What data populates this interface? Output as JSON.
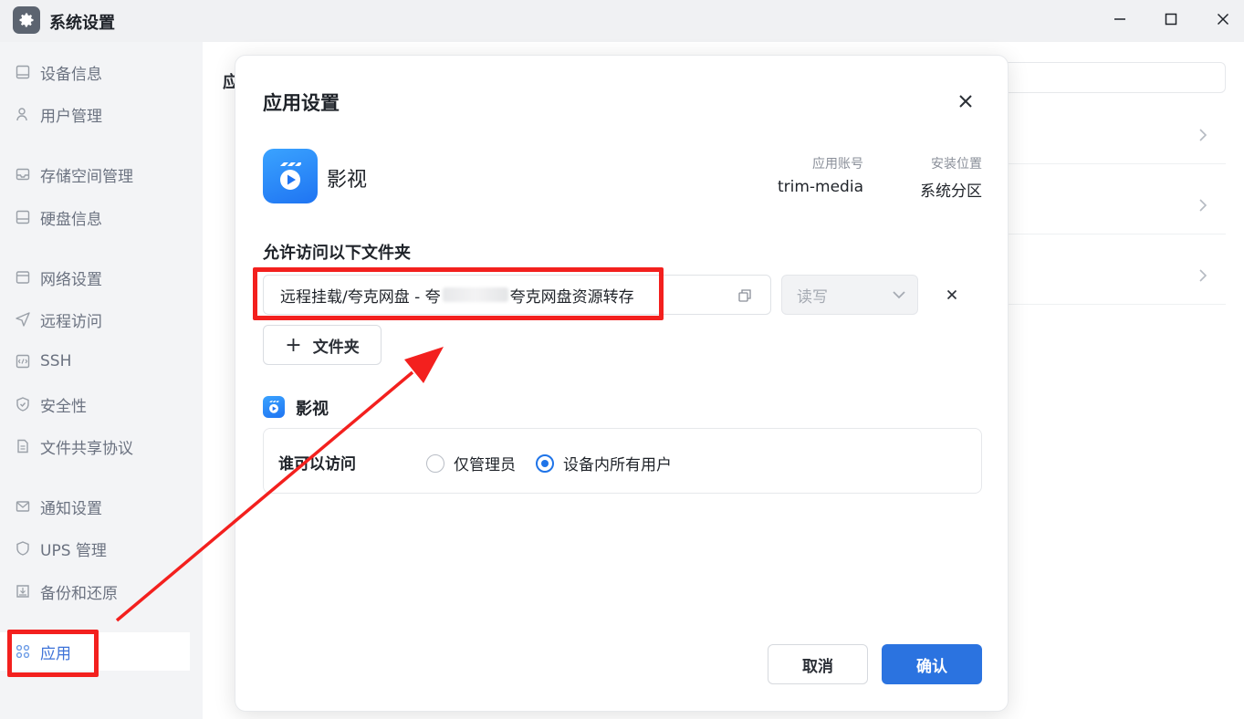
{
  "window": {
    "title": "系统设置",
    "icon": "gear-icon"
  },
  "sidebar": {
    "items": [
      {
        "label": "设备信息",
        "icon": "device-icon"
      },
      {
        "label": "用户管理",
        "icon": "user-icon"
      },
      {
        "label": "存储空间管理",
        "icon": "storage-icon"
      },
      {
        "label": "硬盘信息",
        "icon": "disk-icon"
      },
      {
        "label": "网络设置",
        "icon": "network-icon"
      },
      {
        "label": "远程访问",
        "icon": "send-icon"
      },
      {
        "label": "SSH",
        "icon": "code-icon"
      },
      {
        "label": "安全性",
        "icon": "shield-check-icon"
      },
      {
        "label": "文件共享协议",
        "icon": "file-icon"
      },
      {
        "label": "通知设置",
        "icon": "mail-icon"
      },
      {
        "label": "UPS 管理",
        "icon": "shield-icon"
      },
      {
        "label": "备份和还原",
        "icon": "backup-icon"
      },
      {
        "label": "应用",
        "icon": "apps-grid-icon",
        "active": true
      }
    ]
  },
  "main": {
    "title_partial": "应"
  },
  "modal": {
    "title": "应用设置",
    "app": {
      "name": "影视",
      "account_label": "应用账号",
      "account_value": "trim-media",
      "location_label": "安装位置",
      "location_value": "系统分区"
    },
    "folders_heading": "允许访问以下文件夹",
    "folder_row": {
      "path_prefix": "远程挂载/夸克网盘 - 夸",
      "path_suffix": "夸克网盘资源转存",
      "permission": "读写"
    },
    "add_folder_label": "文件夹",
    "app_section_title": "影视",
    "access": {
      "label": "谁可以访问",
      "options": [
        {
          "label": "仅管理员",
          "checked": false
        },
        {
          "label": "设备内所有用户",
          "checked": true
        }
      ]
    },
    "cancel_label": "取消",
    "confirm_label": "确认"
  },
  "colors": {
    "accent": "#2b73e0",
    "annotation": "#f3201e"
  }
}
